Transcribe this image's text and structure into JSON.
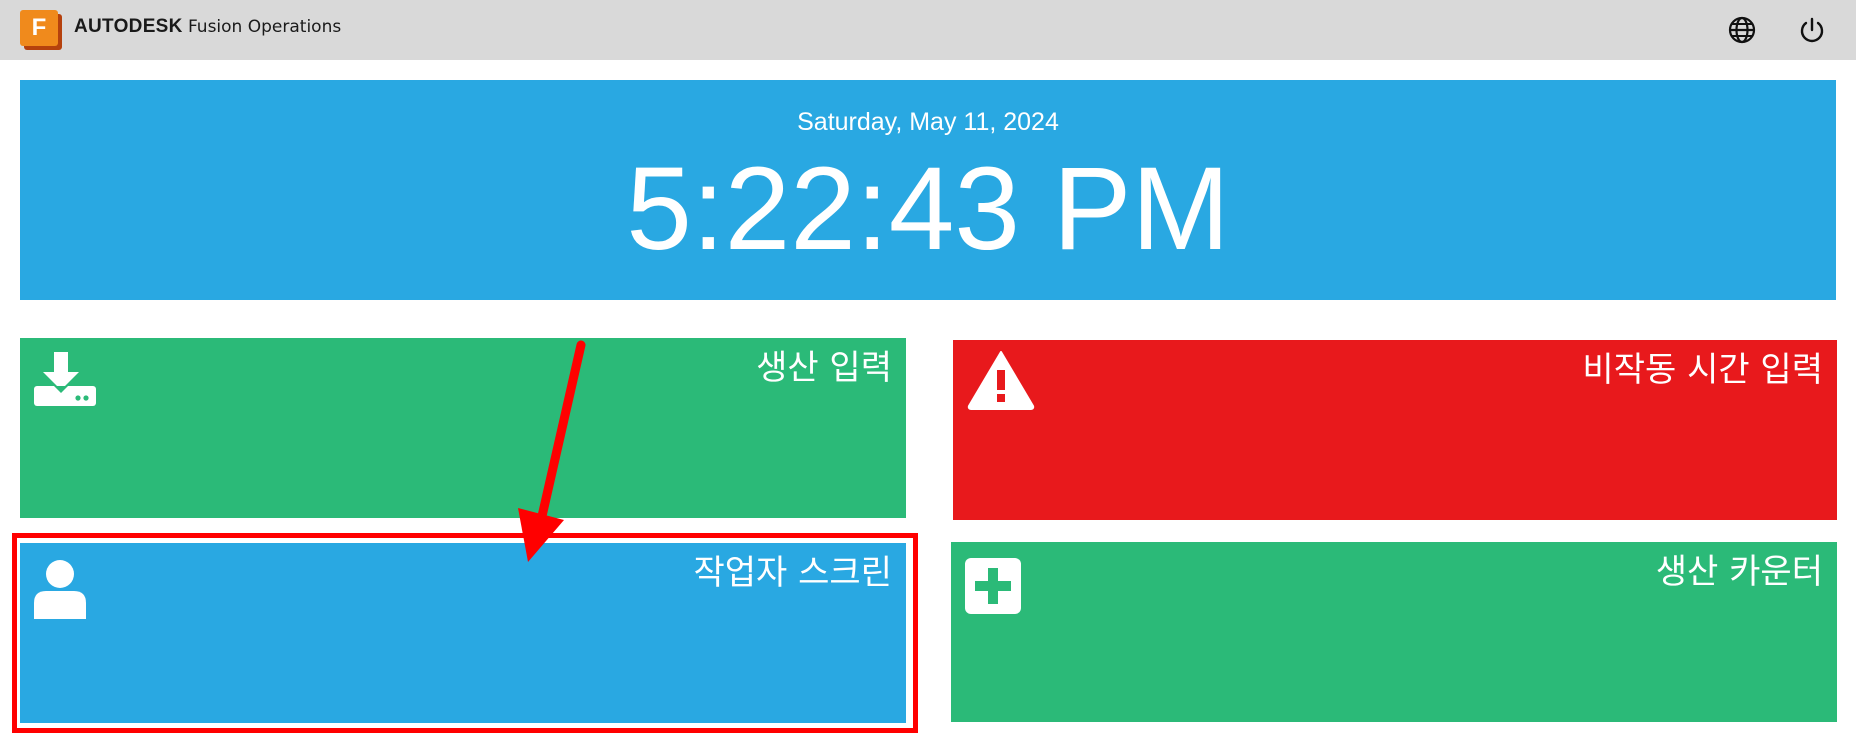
{
  "header": {
    "logo_letter": "F",
    "brand_company": "AUTODESK",
    "brand_product": "Fusion Operations",
    "icons": {
      "language": "globe-icon",
      "logout": "power-icon"
    }
  },
  "clock": {
    "date": "Saturday, May 11, 2024",
    "time": "5:22:43 PM"
  },
  "tiles": [
    {
      "label": "생산 입력",
      "icon": "download-tray-icon",
      "color": "#2bba78"
    },
    {
      "label": "비작동 시간 입력",
      "icon": "warning-icon",
      "color": "#e8191c"
    },
    {
      "label": "작업자 스크린",
      "icon": "user-icon",
      "color": "#29a8e2"
    },
    {
      "label": "생산 카운터",
      "icon": "plus-square-icon",
      "color": "#2bba78"
    }
  ],
  "colors": {
    "header_bg": "#d9d9d9",
    "clock_bg": "#29a8e2",
    "annotation": "#ff0000"
  }
}
